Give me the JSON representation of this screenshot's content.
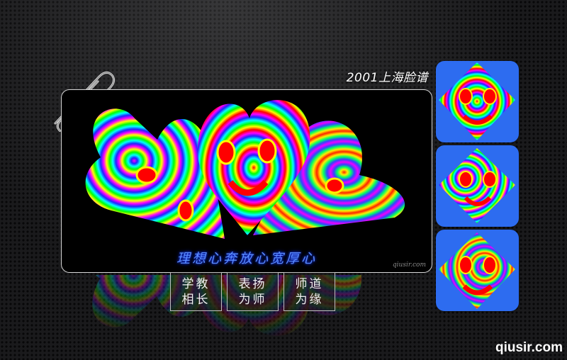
{
  "header": {
    "title": "2001上海脸谱"
  },
  "main_image": {
    "caption": "理想心奔放心宽厚心",
    "watermark": "qiusir.com"
  },
  "mottos": [
    {
      "line1": "学教",
      "line2": "相长"
    },
    {
      "line1": "表扬",
      "line2": "为师"
    },
    {
      "line1": "师道",
      "line2": "为缘"
    }
  ],
  "thumbnails": [
    {
      "name": "mask-thumbnail-1"
    },
    {
      "name": "mask-thumbnail-2"
    },
    {
      "name": "mask-thumbnail-3"
    }
  ],
  "footer": {
    "site": "qiusir.com"
  },
  "colors": {
    "background": "#1a1a1c",
    "caption_blue": "#5a8cff",
    "thumbnail_blue": "#2d6cf0",
    "psychedelic": [
      "#ff0000",
      "#ff8800",
      "#ffff00",
      "#00ff00",
      "#00ffff",
      "#2222ff",
      "#ff00ff"
    ]
  }
}
